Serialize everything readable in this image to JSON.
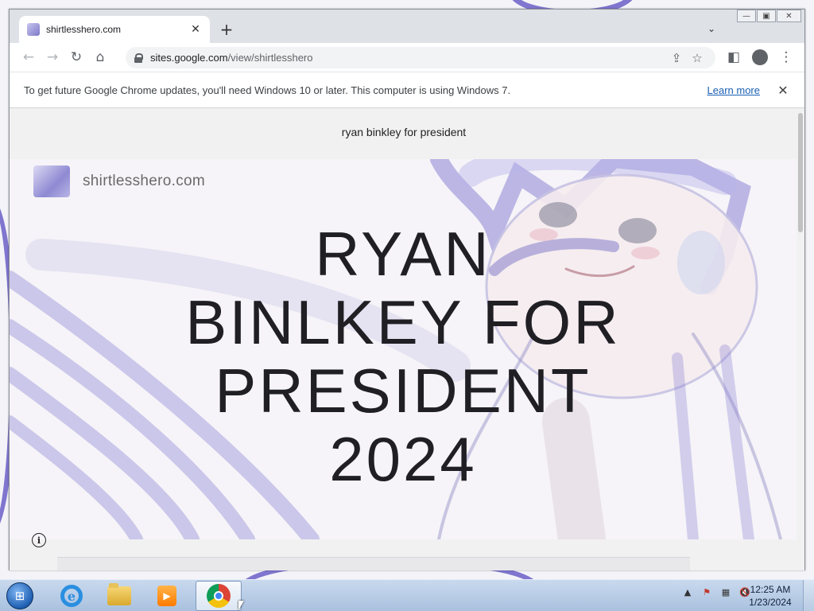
{
  "browser": {
    "tab": {
      "title": "shirtlesshero.com"
    },
    "address_bar": {
      "host": "sites.google.com",
      "path": "/view/shirtlesshero"
    },
    "infobar": {
      "message": "To get future Google Chrome updates, you'll need Windows 10 or later. This computer is using Windows 7.",
      "link_label": "Learn more"
    }
  },
  "page": {
    "site_title": "ryan binkley for president",
    "brand_name": "shirtlesshero.com",
    "headline_lines": [
      "RYAN",
      "BINLKEY FOR",
      "PRESIDENT",
      "2024"
    ]
  },
  "taskbar": {
    "clock_time": "12:25 AM",
    "clock_date": "1/23/2024",
    "pinned": [
      "internet-explorer",
      "windows-explorer",
      "windows-media-player",
      "google-chrome"
    ]
  },
  "colors": {
    "accent_wallpaper": "#6b5fc8",
    "headline": "#1f1f24",
    "link": "#1a5fb4",
    "chrome_frame": "#dee1e6"
  }
}
